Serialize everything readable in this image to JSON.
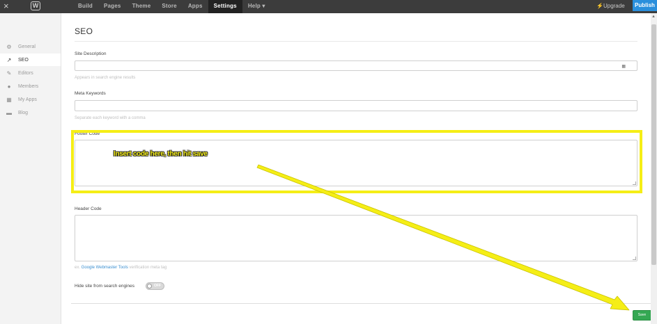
{
  "topbar": {
    "close_icon": "×",
    "logo_glyph": "W",
    "nav": [
      "Build",
      "Pages",
      "Theme",
      "Store",
      "Apps",
      "Settings",
      "Help ▾"
    ],
    "active_nav": "Settings",
    "upgrade_label": "⚡Upgrade",
    "publish_label": "Publish"
  },
  "sidebar": {
    "items": [
      {
        "label": "General",
        "icon": "gear-icon",
        "glyph": "⚙"
      },
      {
        "label": "SEO",
        "icon": "trend-icon",
        "glyph": "↗"
      },
      {
        "label": "Editors",
        "icon": "pencil-icon",
        "glyph": "✎"
      },
      {
        "label": "Members",
        "icon": "person-icon",
        "glyph": "●"
      },
      {
        "label": "My Apps",
        "icon": "grid-icon",
        "glyph": "▦"
      },
      {
        "label": "Blog",
        "icon": "comment-icon",
        "glyph": "▬"
      }
    ],
    "active": "SEO"
  },
  "page": {
    "title": "SEO",
    "site_description": {
      "label": "Site Description",
      "value": "",
      "hint": "Appears in search engine results"
    },
    "meta_keywords": {
      "label": "Meta Keywords",
      "value": "",
      "hint": "Separate each keyword with a comma"
    },
    "footer_code": {
      "label": "Footer Code",
      "value": ""
    },
    "header_code": {
      "label": "Header Code",
      "value": "",
      "hint_prefix": "ex. ",
      "hint_link": "Google Webmaster Tools",
      "hint_suffix": " verification meta tag"
    },
    "hide_site": {
      "label": "Hide site from search engines",
      "state": "OFF"
    },
    "save_label": "Save"
  },
  "annotation": {
    "text": "Insert code here, then hit save",
    "color": "#f5ee16"
  },
  "colors": {
    "topbar": "#3c3c3c",
    "publish": "#2a8fdc",
    "save": "#34a853",
    "link": "#3b8fd0"
  }
}
